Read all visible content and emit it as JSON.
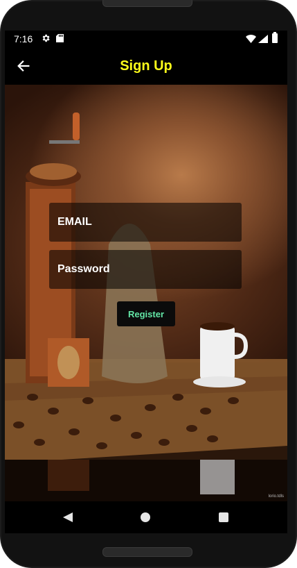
{
  "status_bar": {
    "time": "7:16",
    "icons": [
      "gear-icon",
      "sd-card-icon",
      "wifi-icon",
      "signal-icon",
      "battery-icon"
    ]
  },
  "app_bar": {
    "title": "Sign Up",
    "back_icon": "arrow-left-icon",
    "title_color": "#FFFF1A"
  },
  "form": {
    "email": {
      "placeholder": "EMAIL",
      "value": ""
    },
    "password": {
      "placeholder": "Password",
      "value": ""
    },
    "register_label": "Register",
    "register_color": "#63E6A6"
  },
  "background": {
    "description_icon": "coffee-photo-background",
    "credit": "lorio.tdls"
  },
  "nav_bar": {
    "icons": [
      "nav-back-icon",
      "nav-home-icon",
      "nav-recents-icon"
    ]
  }
}
